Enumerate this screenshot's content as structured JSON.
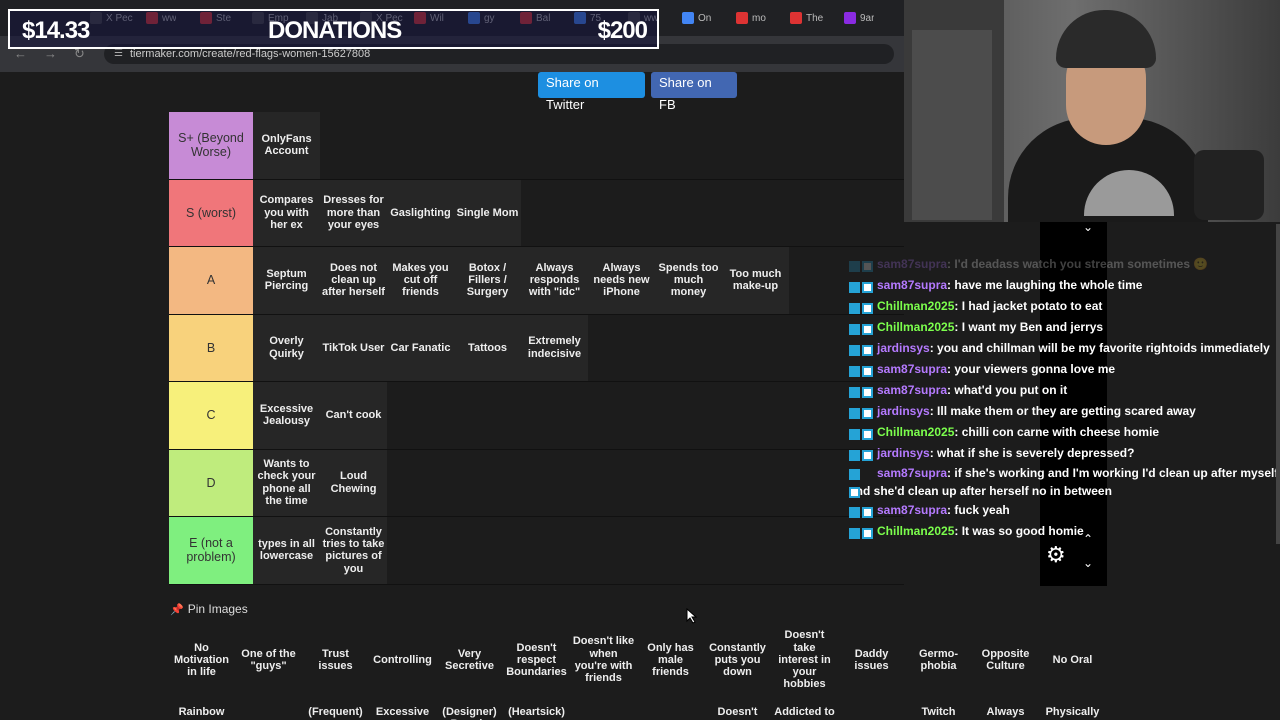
{
  "browser": {
    "tabs": [
      {
        "label": "X  Pec",
        "color": "#444"
      },
      {
        "label": "ww",
        "color": "#d33"
      },
      {
        "label": "Ste",
        "color": "#d33"
      },
      {
        "label": "Emp",
        "color": "#444"
      },
      {
        "label": "Jab",
        "color": "#444"
      },
      {
        "label": "X  Pec",
        "color": "#444"
      },
      {
        "label": "Wil",
        "color": "#d33"
      },
      {
        "label": "gy",
        "color": "#4285f4"
      },
      {
        "label": "Bal",
        "color": "#d33"
      },
      {
        "label": "75",
        "color": "#4285f4"
      },
      {
        "label": "ww",
        "color": "#444"
      },
      {
        "label": "On",
        "color": "#4285f4"
      },
      {
        "label": "mo",
        "color": "#d33"
      },
      {
        "label": "The",
        "color": "#d33"
      },
      {
        "label": "9ar",
        "color": "#8a2be2"
      }
    ],
    "url": "tiermaker.com/create/red-flags-women-15627808"
  },
  "donations": {
    "left": "$14.33",
    "title": "DONATIONS",
    "right": "$200"
  },
  "share": {
    "twitter": "Share on Twitter",
    "fb": "Share on FB"
  },
  "tiers": [
    {
      "label": "S+ (Beyond Worse)",
      "color": "#c78bd6",
      "items": [
        "OnlyFans Account"
      ]
    },
    {
      "label": "S (worst)",
      "color": "#f0767a",
      "items": [
        "Compares you with her ex",
        "Dresses for more than your eyes",
        "Gaslighting",
        "Single Mom"
      ]
    },
    {
      "label": "A",
      "color": "#f3b882",
      "items": [
        "Septum Piercing",
        "Does not clean up after herself",
        "Makes you cut off friends",
        "Botox / Fillers / Surgery",
        "Always responds with \"idc\"",
        "Always needs new iPhone",
        "Spends too much money",
        "Too much make-up"
      ]
    },
    {
      "label": "B",
      "color": "#f8d27c",
      "items": [
        "Overly Quirky",
        "TikTok User",
        "Car Fanatic",
        "Tattoos",
        "Extremely indecisive"
      ]
    },
    {
      "label": "C",
      "color": "#f7f07b",
      "items": [
        "Excessive Jealousy",
        "Can't cook"
      ]
    },
    {
      "label": "D",
      "color": "#bfec7d",
      "items": [
        "Wants to check your phone all the time",
        "Loud Chewing"
      ]
    },
    {
      "label": "E (not a problem)",
      "color": "#7fef7f",
      "items": [
        "types in all lowercase",
        "Constantly tries to take pictures of you"
      ]
    }
  ],
  "pin_images": "Pin Images",
  "pool": [
    "No Motivation in life",
    "One of the \"guys\"",
    "Trust issues",
    "Controlling",
    "Very Secretive",
    "Doesn't respect Boundaries",
    "Doesn't like when you're with friends",
    "Only has male friends",
    "Constantly puts you down",
    "Doesn't take interest in your hobbies",
    "Daddy issues",
    "Germo-phobia",
    "Opposite Culture",
    "No Oral"
  ],
  "pool2": [
    "Rainbow",
    "",
    "(Frequent)",
    "Excessive",
    "(Designer) Brands",
    "(Heartsick)",
    "",
    "",
    "Doesn't",
    "Addicted to",
    "",
    "Twitch",
    "Always",
    "Physically"
  ],
  "chat": [
    {
      "user": "sam87supra",
      "color": "#b57aff",
      "text": ": I'd deadass watch you stream sometimes 🙂",
      "faded": true
    },
    {
      "user": "sam87supra",
      "color": "#b57aff",
      "text": ": have me laughing the whole time"
    },
    {
      "user": "Chillman2025",
      "color": "#7cff4d",
      "text": ": I had jacket potato to eat"
    },
    {
      "user": "Chillman2025",
      "color": "#7cff4d",
      "text": ": I want my Ben and jerrys"
    },
    {
      "user": "jardinsys",
      "color": "#b57aff",
      "text": ": you and chillman will be my favorite rightoids immediately"
    },
    {
      "user": "sam87supra",
      "color": "#b57aff",
      "text": ": your viewers gonna love me"
    },
    {
      "user": "sam87supra",
      "color": "#b57aff",
      "text": ": what'd you put on it"
    },
    {
      "user": "jardinsys",
      "color": "#b57aff",
      "text": ": Ill make them or they are getting scared away"
    },
    {
      "user": "Chillman2025",
      "color": "#7cff4d",
      "text": ": chilli con carne with cheese homie"
    },
    {
      "user": "jardinsys",
      "color": "#b57aff",
      "text": ": what if she is severely depressed?"
    },
    {
      "user": "sam87supra",
      "color": "#b57aff",
      "text": ": if she's working and I'm working I'd clean up after myself and she'd clean up after herself no in between",
      "wrap": true
    },
    {
      "user": "sam87supra",
      "color": "#b57aff",
      "text": ": fuck yeah"
    },
    {
      "user": "Chillman2025",
      "color": "#7cff4d",
      "text": ": It was so good homie"
    }
  ]
}
